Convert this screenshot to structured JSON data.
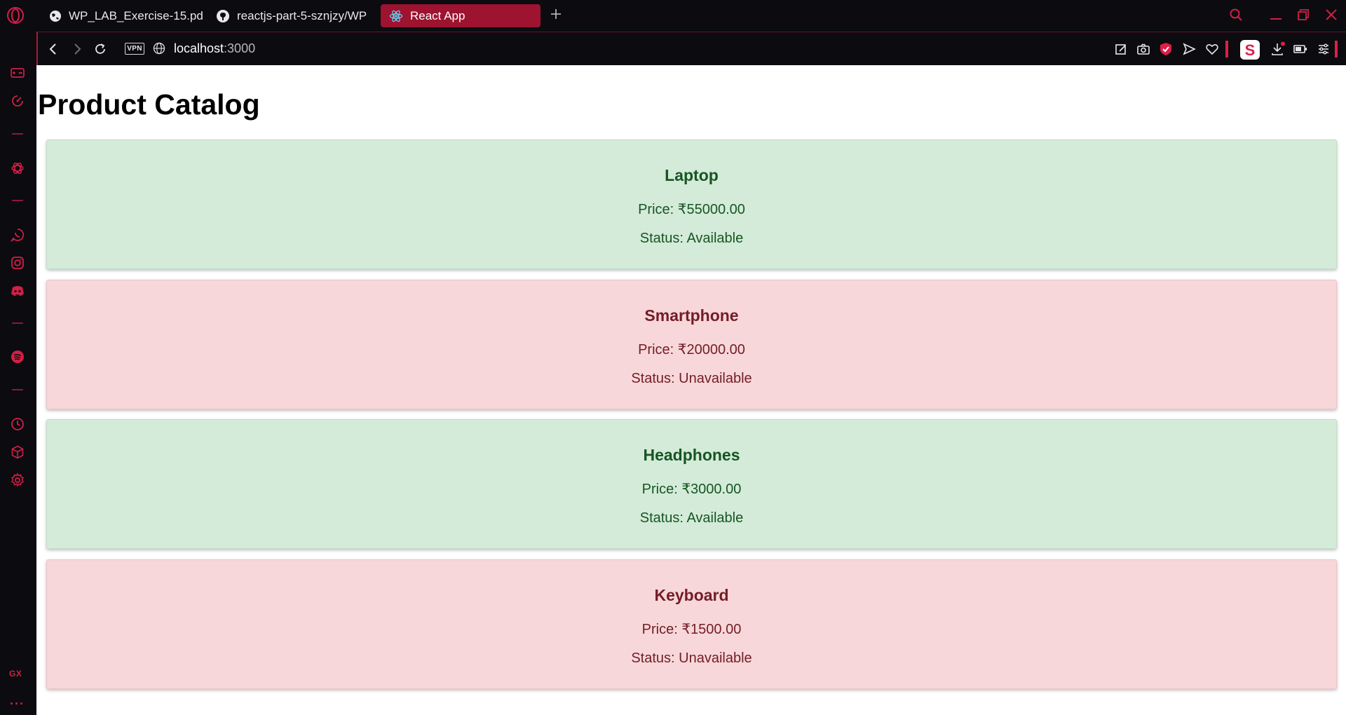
{
  "browser": {
    "tabs": [
      {
        "title": "WP_LAB_Exercise-15.pdf",
        "icon": "globe-icon"
      },
      {
        "title": "reactjs-part-5-sznjzy/WP",
        "icon": "github-icon"
      },
      {
        "title": "React App",
        "icon": "react-icon",
        "active": true
      }
    ],
    "vpn_label": "VPN",
    "url_host": "localhost",
    "url_port": ":3000",
    "accent_color": "#d21f45",
    "active_tab_color": "#9e1330"
  },
  "sidebar": {
    "icons": [
      "game-controller-icon",
      "speed-dial-icon",
      "chatgpt-icon",
      "whatsapp-icon",
      "instagram-icon",
      "discord-icon",
      "spotify-icon",
      "history-icon",
      "extensions-icon",
      "settings-icon"
    ],
    "gx_label": "GX",
    "more_label": "···"
  },
  "page": {
    "title": "Product Catalog",
    "products": [
      {
        "name": "Laptop",
        "price": "Price: ₹55000.00",
        "status": "Status: Available",
        "available": true
      },
      {
        "name": "Smartphone",
        "price": "Price: ₹20000.00",
        "status": "Status: Unavailable",
        "available": false
      },
      {
        "name": "Headphones",
        "price": "Price: ₹3000.00",
        "status": "Status: Available",
        "available": true
      },
      {
        "name": "Keyboard",
        "price": "Price: ₹1500.00",
        "status": "Status: Unavailable",
        "available": false
      }
    ],
    "available_bg": "#d4ebd9",
    "available_text": "#165622",
    "unavailable_bg": "#f7d7da",
    "unavailable_text": "#731d26"
  }
}
